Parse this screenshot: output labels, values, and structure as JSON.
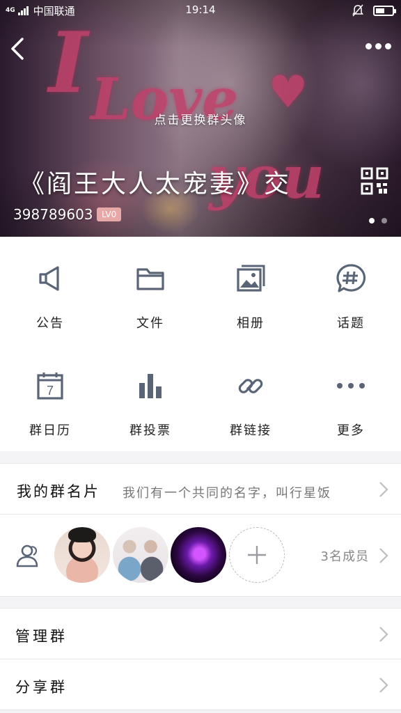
{
  "status_bar": {
    "network_type": "4G",
    "carrier": "中国联通",
    "time": "19:14",
    "icons": [
      "signal-bars-icon",
      "mute-bell-icon",
      "battery-icon"
    ]
  },
  "header": {
    "avatar_hint": "点击更换群头像",
    "group_name": "《阎王大人太宠妻》交",
    "group_id": "398789603",
    "level_badge": "LV0",
    "page_dots": 2,
    "active_dot": 0,
    "icons": [
      "back-arrow-icon",
      "more-dots-icon",
      "qr-code-icon"
    ]
  },
  "functions": [
    {
      "label": "公告",
      "icon": "megaphone-icon"
    },
    {
      "label": "文件",
      "icon": "folder-icon"
    },
    {
      "label": "相册",
      "icon": "photo-album-icon"
    },
    {
      "label": "话题",
      "icon": "hashtag-bubble-icon"
    },
    {
      "label": "群日历",
      "icon": "calendar-icon",
      "calendar_day": "7"
    },
    {
      "label": "群投票",
      "icon": "bar-chart-icon"
    },
    {
      "label": "群链接",
      "icon": "link-icon"
    },
    {
      "label": "更多",
      "icon": "more-dots-icon"
    }
  ],
  "group_card": {
    "label": "我的群名片",
    "value": "我们有一个共同的名字，叫行星饭"
  },
  "members": {
    "count_label": "3名成员",
    "avatars": [
      "member-avatar-1",
      "member-avatar-2",
      "member-avatar-3"
    ]
  },
  "actions": {
    "manage_label": "管理群",
    "share_label": "分享群"
  },
  "colors": {
    "icon_gray": "#5a6477",
    "badge": "#e7a8a8",
    "text_secondary": "#777777",
    "separator": "#e6e6e8"
  }
}
